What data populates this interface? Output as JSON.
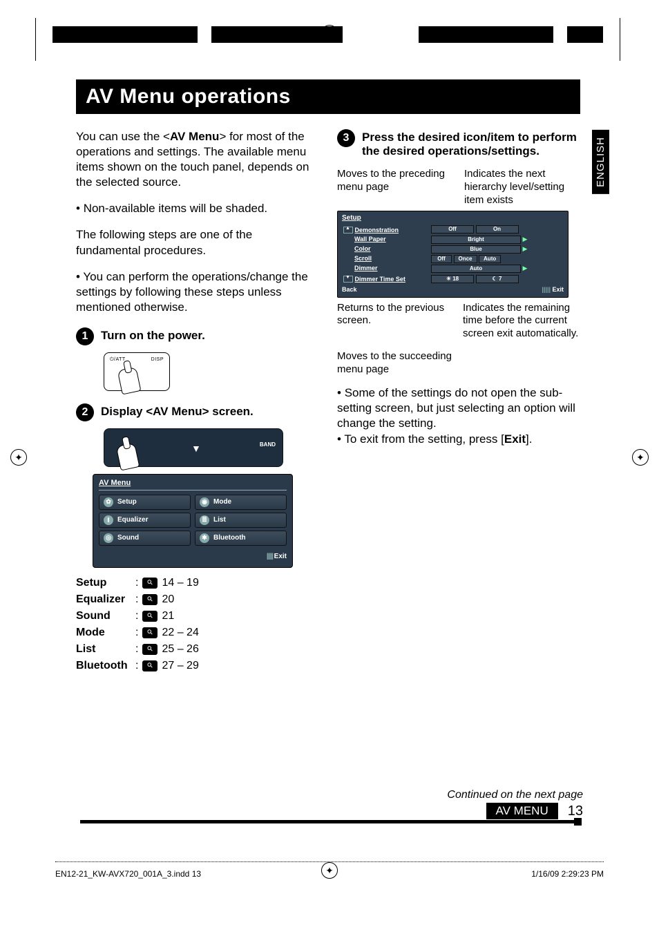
{
  "title": "AV Menu operations",
  "sidetab": "ENGLISH",
  "intro": {
    "p1a": "You can use the <",
    "p1b": "AV Menu",
    "p1c": "> for most of the operations and settings. The available menu items shown on the touch panel, depends on the selected source.",
    "bul1": "Non-available items will be shaded.",
    "p2": "The following steps are one of the fundamental procedures.",
    "bul2": "You can perform the operations/change the settings by following these steps unless mentioned otherwise."
  },
  "steps": {
    "s1": "Turn on the power.",
    "s2": "Display <AV Menu> screen.",
    "s3": "Press the desired icon/item to perform the desired operations/settings."
  },
  "device_labels": {
    "att": "/ATT",
    "disp": "DISP",
    "band": "BAND"
  },
  "av_menu_panel": {
    "title": "AV Menu",
    "items": [
      {
        "label": "Setup"
      },
      {
        "label": "Mode"
      },
      {
        "label": "Equalizer"
      },
      {
        "label": "List"
      },
      {
        "label": "Sound"
      },
      {
        "label": "Bluetooth"
      }
    ],
    "exit": "Exit"
  },
  "page_refs": [
    {
      "label": "Setup",
      "pages": "14 – 19"
    },
    {
      "label": "Equalizer",
      "pages": "20"
    },
    {
      "label": "Sound",
      "pages": "21"
    },
    {
      "label": "Mode",
      "pages": "22 – 24"
    },
    {
      "label": "List",
      "pages": "25 – 26"
    },
    {
      "label": "Bluetooth",
      "pages": "27 – 29"
    }
  ],
  "callouts": {
    "top_left": "Moves to the preceding menu page",
    "top_right": "Indicates the next hierarchy level/setting item exists",
    "bot_left": "Returns to the previous screen.",
    "bot_right": "Indicates the remaining time before the current screen exit automatically.",
    "succeed": "Moves to the succeeding menu page"
  },
  "setup_panel": {
    "title": "Setup",
    "rows": [
      {
        "name": "Demonstration",
        "opts": [
          "Off",
          "On"
        ]
      },
      {
        "name": "Wall Paper",
        "opts": [
          "Bright"
        ]
      },
      {
        "name": "Color",
        "opts": [
          "Blue"
        ]
      },
      {
        "name": "Scroll",
        "opts": [
          "Off",
          "Once",
          "Auto"
        ]
      },
      {
        "name": "Dimmer",
        "opts": [
          "Auto"
        ]
      },
      {
        "name": "Dimmer Time Set",
        "opts": [
          "18",
          "7"
        ]
      }
    ],
    "back": "Back",
    "exit": "Exit"
  },
  "notes": {
    "n1": "Some of the settings do not open the sub-setting screen, but just selecting an option will change the setting.",
    "n2a": "To exit from the setting, press [",
    "n2b": "Exit",
    "n2c": "]."
  },
  "continued": "Continued on the next page",
  "footer_badge": {
    "label": "AV MENU",
    "page": "13"
  },
  "print_footer": {
    "file": "EN12-21_KW-AVX720_001A_3.indd   13",
    "stamp": "1/16/09   2:29:23 PM"
  }
}
